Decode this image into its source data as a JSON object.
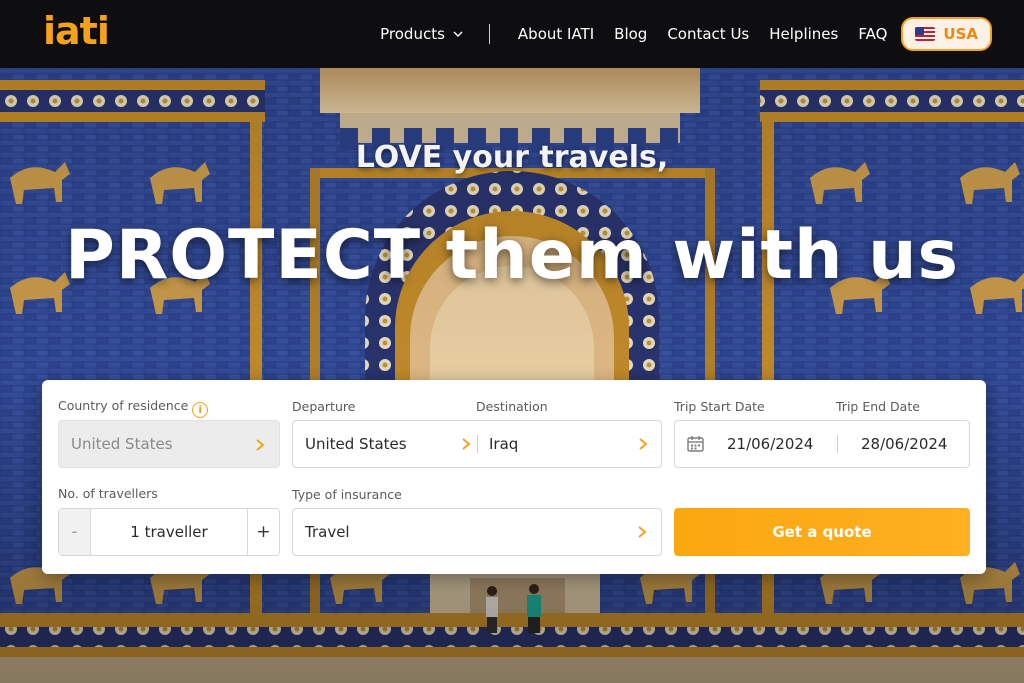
{
  "brand": {
    "logo_text": "iati",
    "accent": "#f5a21b"
  },
  "nav": {
    "products_label": "Products",
    "items": [
      "About IATI",
      "Blog",
      "Contact Us",
      "Helplines",
      "FAQ"
    ],
    "country_label": "USA",
    "country_flag": "us-flag-icon"
  },
  "hero": {
    "tagline": "LOVE your travels,",
    "title": "PROTECT them with us"
  },
  "form": {
    "residence": {
      "label": "Country of residence",
      "value": "United States",
      "info_icon": "info-icon"
    },
    "departure": {
      "label": "Departure",
      "value": "United States"
    },
    "destination": {
      "label": "Destination",
      "value": "Iraq"
    },
    "start_date": {
      "label": "Trip Start Date",
      "value": "21/06/2024"
    },
    "end_date": {
      "label": "Trip End Date",
      "value": "28/06/2024"
    },
    "travellers": {
      "label": "No. of travellers",
      "value": "1 traveller",
      "minus": "-",
      "plus": "+"
    },
    "insurance": {
      "label": "Type of insurance",
      "value": "Travel"
    },
    "submit_label": "Get a quote",
    "calendar_icon": "calendar-icon"
  }
}
